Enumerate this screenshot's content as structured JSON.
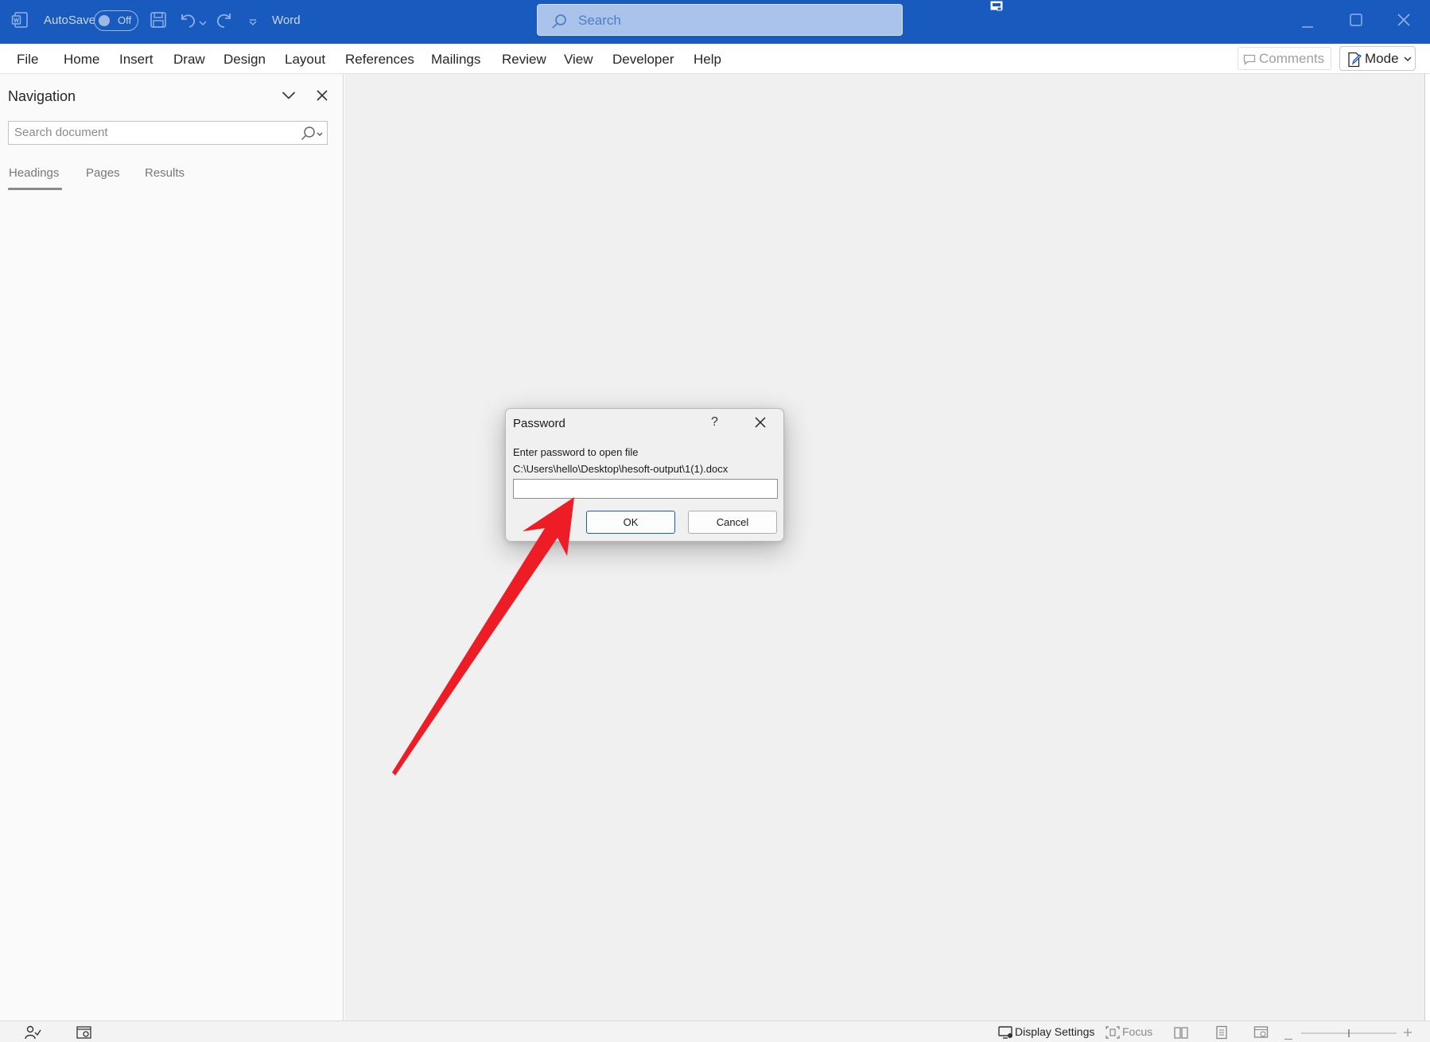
{
  "titlebar": {
    "autosave_label": "AutoSave",
    "autosave_state": "Off",
    "app_name": "Word",
    "search_placeholder": "Search",
    "accent_color": "#185abd"
  },
  "menu": {
    "items": [
      "File",
      "Home",
      "Insert",
      "Draw",
      "Design",
      "Layout",
      "References",
      "Mailings",
      "Review",
      "View",
      "Developer",
      "Help"
    ],
    "comments_label": "Comments",
    "mode_label": "Mode"
  },
  "navigation": {
    "title": "Navigation",
    "search_placeholder": "Search document",
    "tabs": [
      "Headings",
      "Pages",
      "Results"
    ],
    "active_tab": "Headings"
  },
  "dialog": {
    "title": "Password",
    "help_glyph": "?",
    "message": "Enter password to open file",
    "file_path": "C:\\Users\\hello\\Desktop\\hesoft-output\\1(1).docx",
    "password_value": "",
    "ok_label": "OK",
    "cancel_label": "Cancel"
  },
  "statusbar": {
    "display_settings_label": "Display Settings",
    "focus_label": "Focus"
  },
  "annotation": {
    "arrow_color": "#ee1c25"
  }
}
